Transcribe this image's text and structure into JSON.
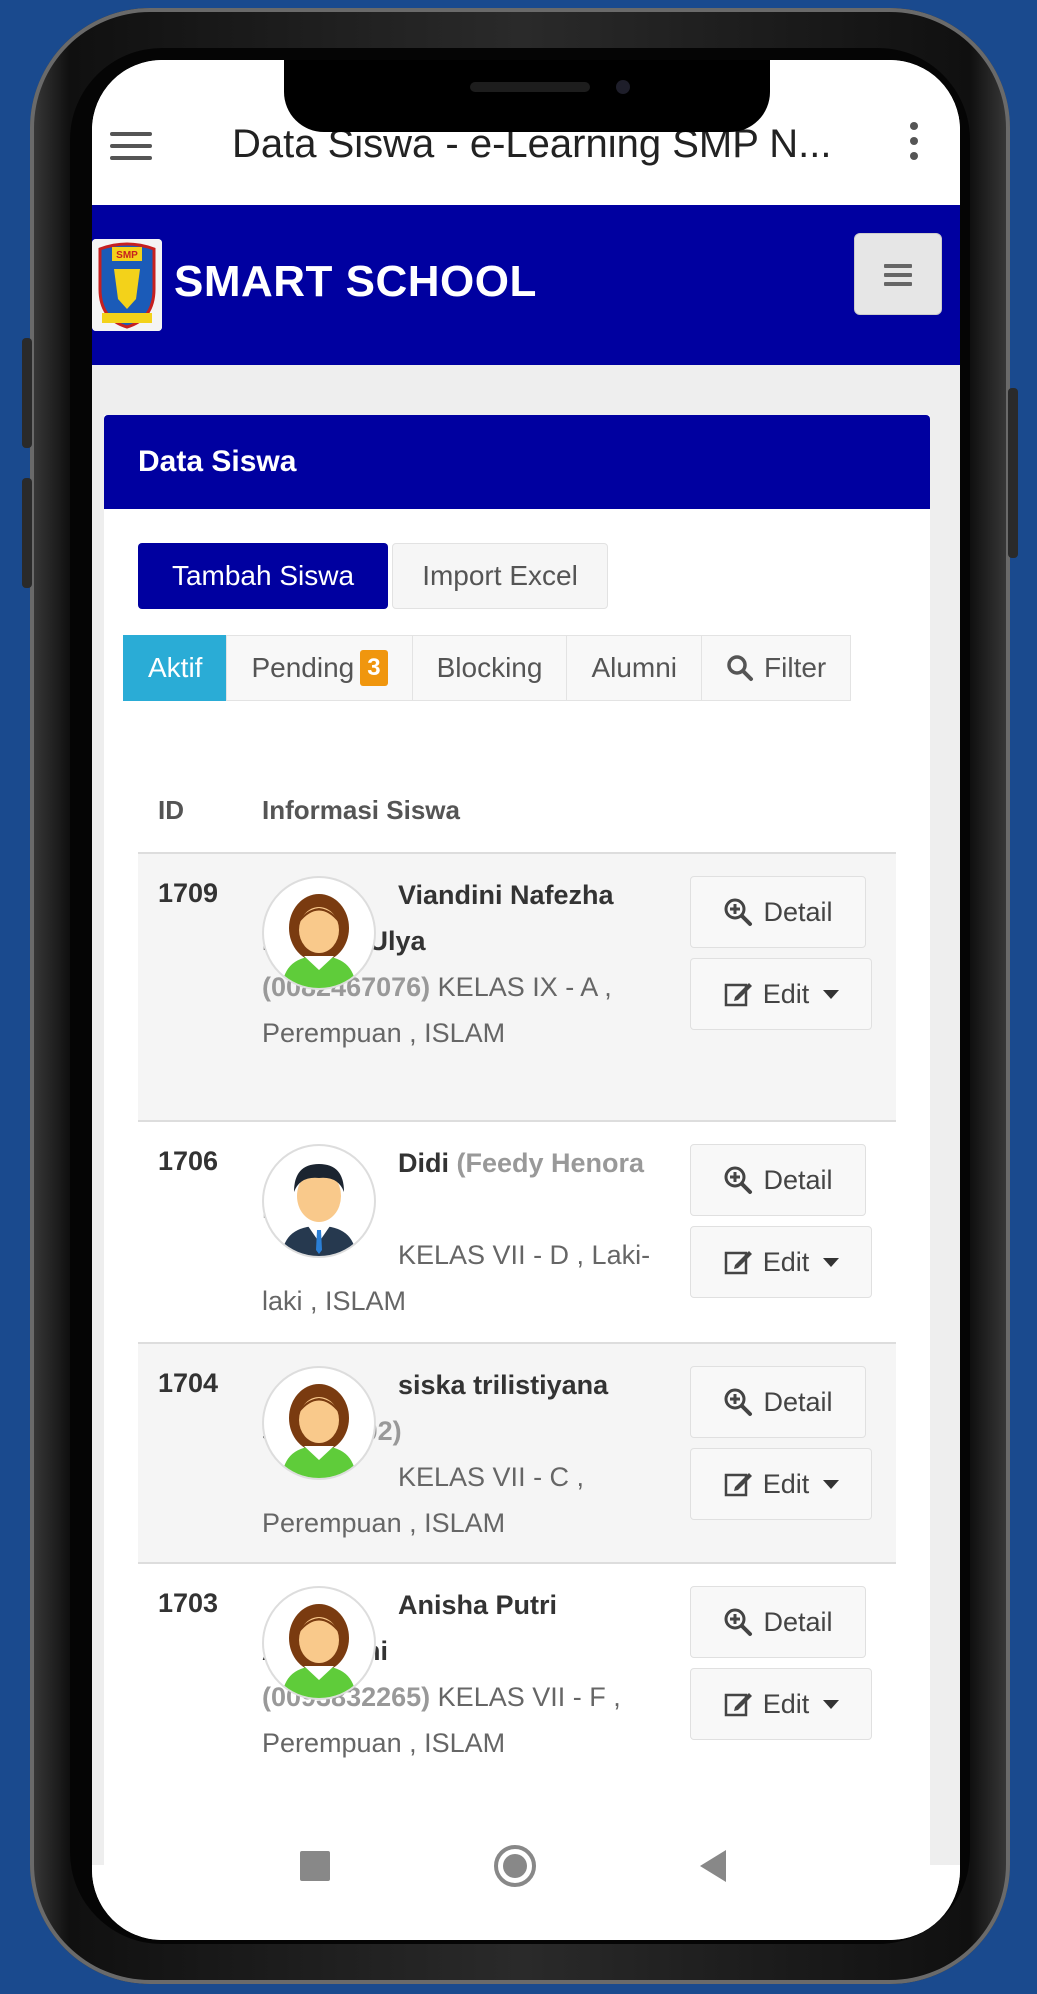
{
  "browser": {
    "title": "Data Siswa - e-Learning SMP N..."
  },
  "header": {
    "brand": "SMART SCHOOL",
    "logo_text": "SMP"
  },
  "card": {
    "title": "Data Siswa"
  },
  "actions": {
    "add": "Tambah Siswa",
    "import": "Import Excel"
  },
  "tabs": {
    "aktif": "Aktif",
    "pending": "Pending",
    "pending_count": "3",
    "blocking": "Blocking",
    "alumni": "Alumni",
    "filter": "Filter"
  },
  "table": {
    "col_id": "ID",
    "col_info": "Informasi Siswa"
  },
  "buttons": {
    "detail": "Detail",
    "edit": "Edit"
  },
  "students": [
    {
      "id": "1709",
      "name": "Viandini Nafezha Himatul Ulya",
      "nis": "(0082467076)",
      "details": "KELAS IX - A , Perempuan , ISLAM",
      "gender": "female"
    },
    {
      "id": "1706",
      "name": "Didi",
      "nis": "(Feedy Henora K.R)",
      "details": "KELAS VII - D , Laki-laki , ISLAM",
      "gender": "male"
    },
    {
      "id": "1704",
      "name": "siska trilistiyana slim",
      "nis": "(9902)",
      "details": "KELAS VII - C , Perempuan , ISLAM",
      "gender": "female"
    },
    {
      "id": "1703",
      "name": "Anisha Putri Anggraini",
      "nis": "(0093832265)",
      "details": "KELAS VII - F , Perempuan , ISLAM",
      "gender": "female"
    }
  ],
  "colors": {
    "brand": "#0000a0",
    "active_tab": "#2aacd6",
    "badge": "#f0960e",
    "background": "#1a4a8e"
  },
  "icons": {
    "menu": "hamburger-icon",
    "overflow": "kebab-icon",
    "detail": "zoom-in-icon",
    "edit": "edit-icon",
    "filter": "search-icon"
  }
}
